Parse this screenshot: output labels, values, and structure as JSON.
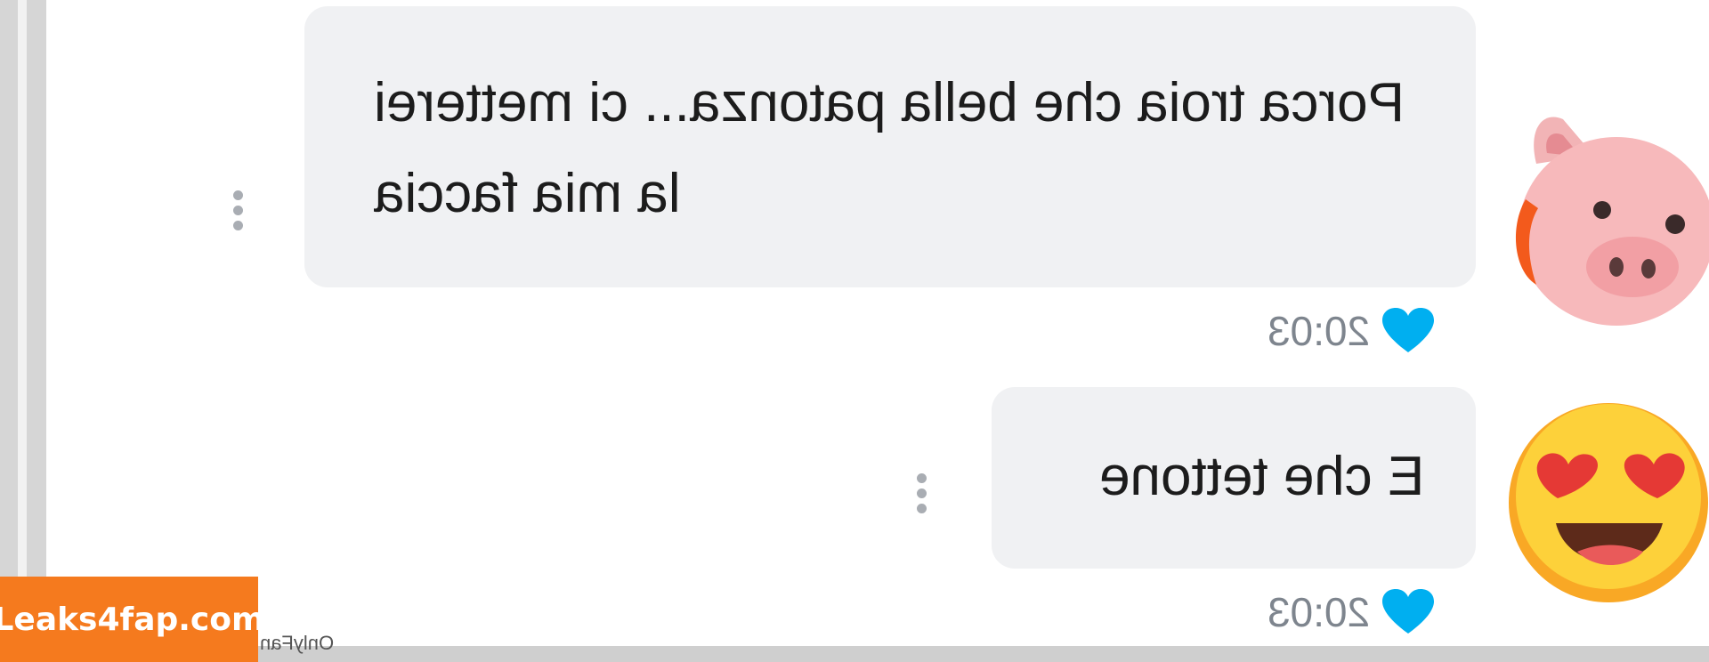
{
  "messages": [
    {
      "text": "Porca troia che bella patonza... ci metterei la mia faccia",
      "time": "20:03",
      "avatar_icon": "pig-face-emoji",
      "liked": true
    },
    {
      "text": "E che tettone",
      "time": "20:03",
      "avatar_icon": "heart-eyes-emoji",
      "liked": true
    }
  ],
  "watermark": {
    "label": "Leaks4fap.com",
    "source": "OnlyFan"
  },
  "colors": {
    "bubble": "#f0f1f3",
    "heart": "#00aff0",
    "watermark": "#f57a1e",
    "time": "#7e858e"
  }
}
